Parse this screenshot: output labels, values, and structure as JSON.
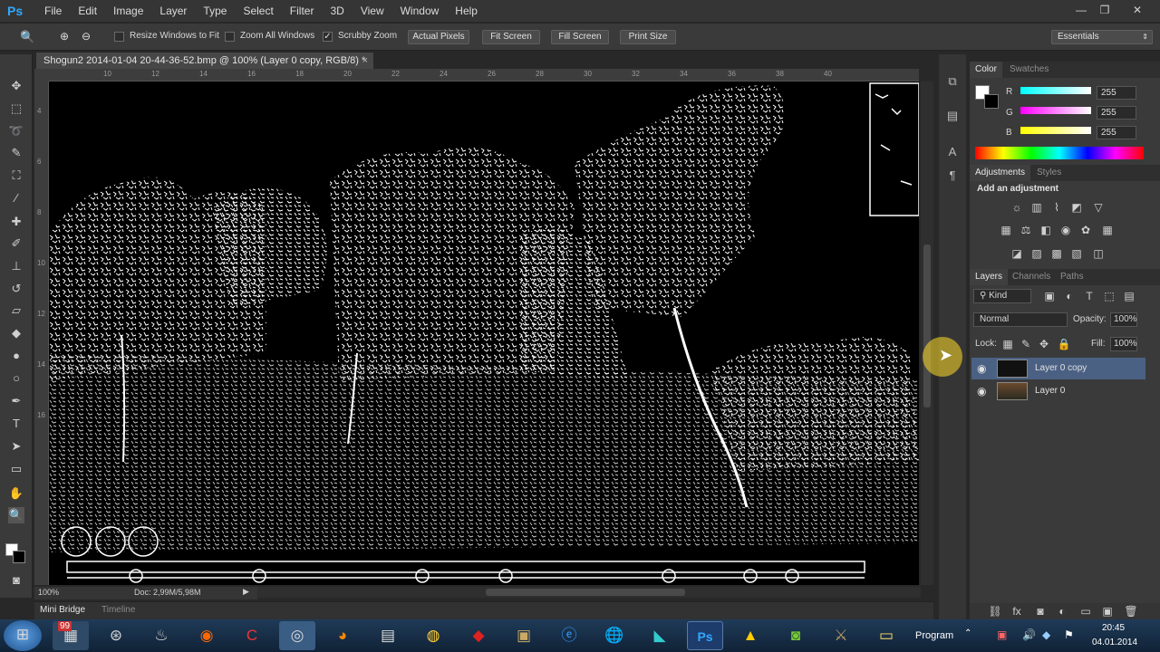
{
  "menu": {
    "logo": "Ps",
    "items": [
      "File",
      "Edit",
      "Image",
      "Layer",
      "Type",
      "Select",
      "Filter",
      "3D",
      "View",
      "Window",
      "Help"
    ]
  },
  "options": {
    "resize_windows": "Resize Windows to Fit",
    "zoom_all": "Zoom All Windows",
    "scrubby_zoom": "Scrubby Zoom",
    "actual_pixels": "Actual Pixels",
    "fit_screen": "Fit Screen",
    "fill_screen": "Fill Screen",
    "print_size": "Print Size",
    "workspace": "Essentials",
    "scrubby_checked": true
  },
  "document": {
    "tab_title": "Shogun2 2014-01-04 20-44-36-52.bmp @ 100% (Layer 0 copy, RGB/8) *",
    "zoom": "100%",
    "doc_size": "Doc: 2,99M/5,98M",
    "ruler_top": [
      "10",
      "12",
      "14",
      "16",
      "18",
      "20",
      "22",
      "24",
      "26",
      "28",
      "30",
      "32",
      "34",
      "36",
      "38",
      "40"
    ],
    "ruler_left": [
      "4",
      "6",
      "8",
      "10",
      "12",
      "14",
      "16"
    ]
  },
  "bottom_tabs": {
    "mini_bridge": "Mini Bridge",
    "timeline": "Timeline"
  },
  "color_panel": {
    "tab_color": "Color",
    "tab_swatches": "Swatches",
    "r_label": "R",
    "g_label": "G",
    "b_label": "B",
    "r": "255",
    "g": "255",
    "b": "255"
  },
  "adjustments_panel": {
    "tab_adjustments": "Adjustments",
    "tab_styles": "Styles",
    "heading": "Add an adjustment"
  },
  "layers_panel": {
    "tab_layers": "Layers",
    "tab_channels": "Channels",
    "tab_paths": "Paths",
    "filter_kind": "Kind",
    "blend_mode": "Normal",
    "opacity_label": "Opacity:",
    "opacity": "100%",
    "lock_label": "Lock:",
    "fill_label": "Fill:",
    "fill": "100%",
    "layers": [
      {
        "name": "Layer 0 copy",
        "selected": true
      },
      {
        "name": "Layer 0",
        "selected": false
      }
    ]
  },
  "taskbar": {
    "badge": "99",
    "lang": "Program",
    "time": "20:45",
    "date": "04.01.2014"
  }
}
